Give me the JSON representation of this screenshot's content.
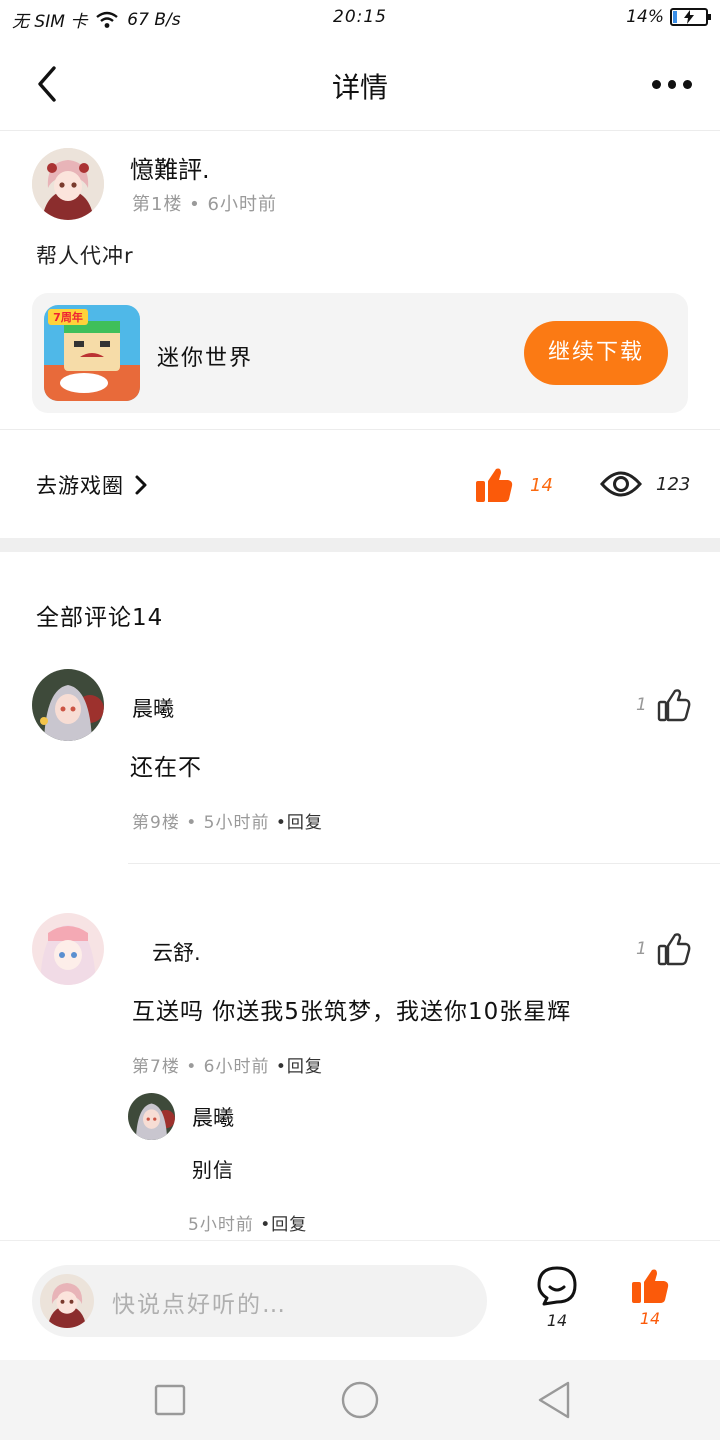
{
  "status_bar": {
    "carrier": "无 SIM 卡",
    "speed": "67 B/s",
    "time": "20:15",
    "battery": "14%",
    "battery_level": 0.14
  },
  "nav": {
    "title": "详情"
  },
  "post": {
    "author": "憶難評.",
    "meta": "第1楼 • 6小时前",
    "text": "帮人代冲r"
  },
  "game": {
    "icon_badge": "7周年",
    "name": "迷你世界",
    "button": "继续下载"
  },
  "actions": {
    "go_circle": "去游戏圈",
    "likes": "14",
    "views": "123"
  },
  "comments_header": "全部评论14",
  "comments": [
    {
      "name": "晨曦",
      "text": "还在不",
      "meta": "第9楼 • 5小时前",
      "reply": "•回复",
      "likes": "1"
    },
    {
      "name": "云舒.",
      "text": "互送吗 你送我5张筑梦，我送你10张星辉",
      "meta": "第7楼 • 6小时前",
      "reply": "•回复",
      "likes": "1",
      "sub_reply": {
        "name": "晨曦",
        "text": "别信",
        "meta": "5小时前",
        "reply": "•回复"
      }
    }
  ],
  "bottom_bar": {
    "placeholder": "快说点好听的…",
    "comment_count": "14",
    "like_count": "14"
  },
  "colors": {
    "accent": "#fb7a14",
    "like_active": "#fb5a0a",
    "battery": "#3a8ee6"
  },
  "icons": [
    "back-arrow-icon",
    "more-icon",
    "chevron-right-icon",
    "thumbs-up-icon",
    "eye-icon",
    "chat-bubble-icon",
    "recent-apps-icon",
    "home-icon",
    "back-triangle-icon",
    "wifi-icon",
    "battery-icon"
  ]
}
